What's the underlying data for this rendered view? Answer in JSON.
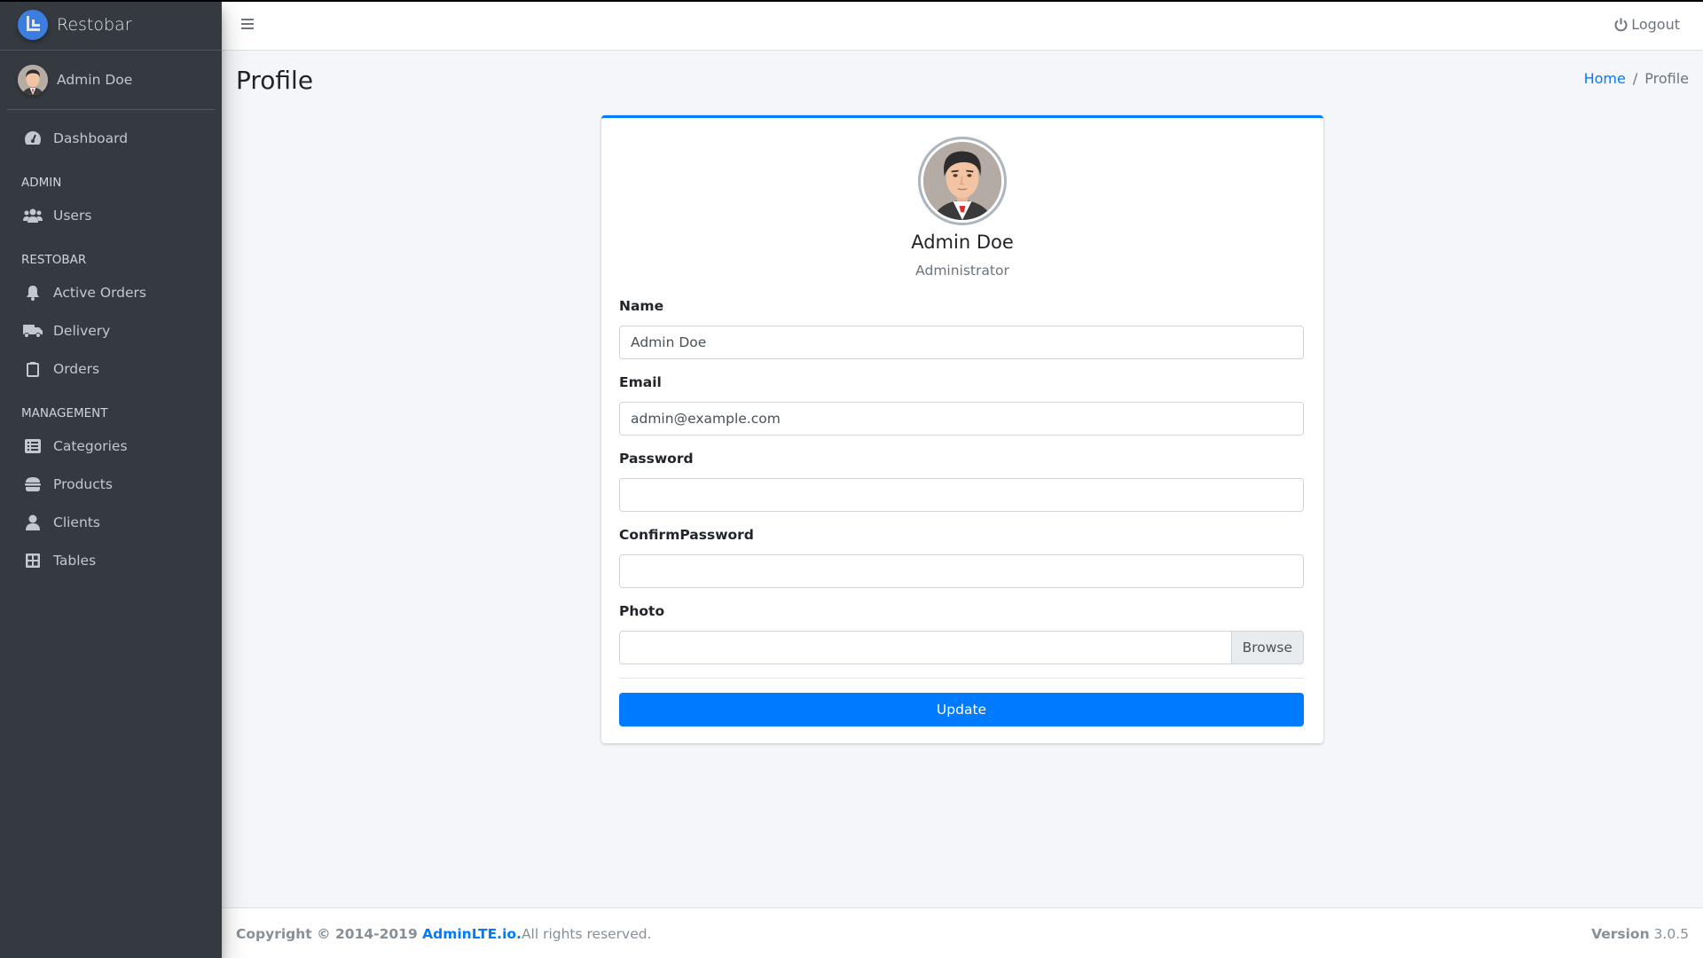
{
  "brand": {
    "name": "Restobar"
  },
  "user": {
    "name": "Admin Doe",
    "role": "Administrator"
  },
  "sidebar": {
    "items": [
      {
        "type": "item",
        "label": "Dashboard",
        "icon": "tachometer-icon"
      },
      {
        "type": "header",
        "label": "ADMIN"
      },
      {
        "type": "item",
        "label": "Users",
        "icon": "users-icon"
      },
      {
        "type": "header",
        "label": "RESTOBAR"
      },
      {
        "type": "item",
        "label": "Active Orders",
        "icon": "bell-icon"
      },
      {
        "type": "item",
        "label": "Delivery",
        "icon": "truck-icon"
      },
      {
        "type": "item",
        "label": "Orders",
        "icon": "clipboard-icon"
      },
      {
        "type": "header",
        "label": "MANAGEMENT"
      },
      {
        "type": "item",
        "label": "Categories",
        "icon": "list-alt-icon"
      },
      {
        "type": "item",
        "label": "Products",
        "icon": "hamburger-food-icon"
      },
      {
        "type": "item",
        "label": "Clients",
        "icon": "user-icon"
      },
      {
        "type": "item",
        "label": "Tables",
        "icon": "table-grid-icon"
      }
    ]
  },
  "navbar": {
    "logout_label": "Logout"
  },
  "page": {
    "title": "Profile"
  },
  "breadcrumb": {
    "home": "Home",
    "separator": "/",
    "current": "Profile"
  },
  "form": {
    "name_label": "Name",
    "name_value": "Admin Doe",
    "email_label": "Email",
    "email_value": "admin@example.com",
    "password_label": "Password",
    "password_value": "",
    "confirm_label": "ConfirmPassword",
    "confirm_value": "",
    "photo_label": "Photo",
    "browse_label": "Browse",
    "update_label": "Update"
  },
  "footer": {
    "copyright": "Copyright © 2014-2019 ",
    "link": "AdminLTE.io.",
    "rights": "All rights reserved.",
    "version_label": "Version",
    "version": " 3.0.5"
  },
  "colors": {
    "sidebar_bg": "#343a40",
    "primary": "#007bff",
    "content_bg": "#f4f6f9"
  }
}
